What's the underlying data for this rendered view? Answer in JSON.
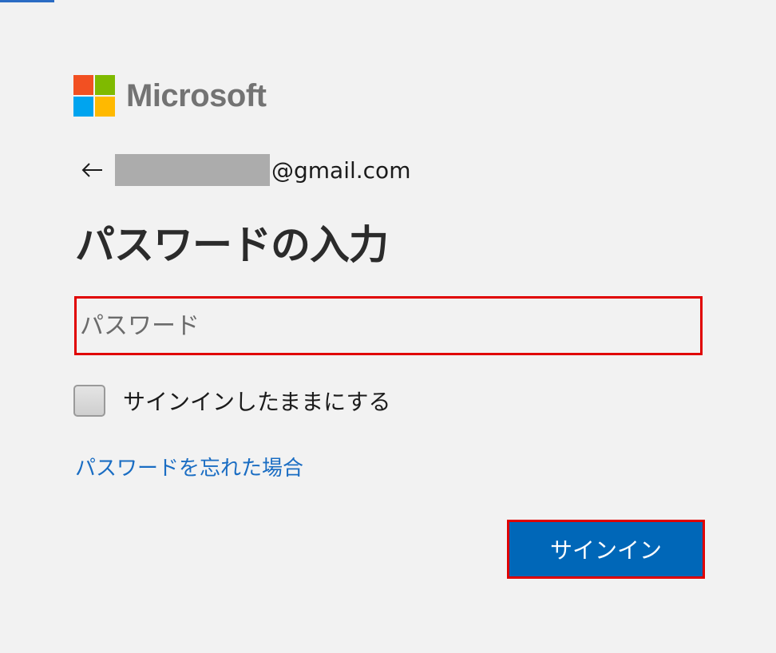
{
  "brand": {
    "name": "Microsoft",
    "colors": {
      "red": "#f25022",
      "green": "#7fba00",
      "blue": "#00a4ef",
      "yellow": "#ffb900"
    }
  },
  "identity": {
    "back_icon": "back-arrow-icon",
    "email_suffix": "@gmail.com"
  },
  "heading": "パスワードの入力",
  "password": {
    "placeholder": "パスワード",
    "value": ""
  },
  "keep_signed_in": {
    "label": "サインインしたままにする",
    "checked": false
  },
  "forgot_link": "パスワードを忘れた場合",
  "signin_button": "サインイン",
  "accent_colors": {
    "button": "#0067b8",
    "link": "#1a6dc3",
    "highlight_border": "#e00000"
  }
}
